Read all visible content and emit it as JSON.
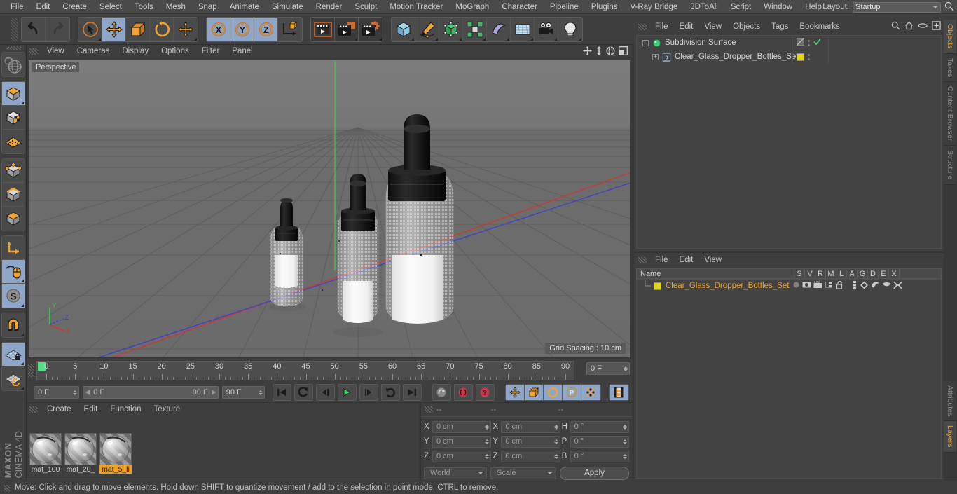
{
  "app": {
    "brand_top": "MAXON",
    "brand_bottom": "CINEMA 4D"
  },
  "menubar": {
    "items": [
      "File",
      "Edit",
      "Create",
      "Select",
      "Tools",
      "Mesh",
      "Snap",
      "Animate",
      "Simulate",
      "Render",
      "Sculpt",
      "Motion Tracker",
      "MoGraph",
      "Character",
      "Pipeline",
      "Plugins",
      "V-Ray Bridge",
      "3DToAll",
      "Script",
      "Window",
      "Help"
    ],
    "layout_label": "Layout:",
    "layout_value": "Startup"
  },
  "toolbar": {
    "undo": "undo-arrow",
    "redo": "redo-arrow",
    "tools": [
      "live-selection",
      "move",
      "scale",
      "rotate",
      "move-axis"
    ],
    "axes": [
      "X",
      "Y",
      "Z"
    ],
    "world_axis": "world-coordinate-system",
    "render_view": "render-view",
    "render_region": "render-region",
    "render_settings": "render-settings",
    "primitives": [
      "cube-primitive",
      "pen-spline",
      "generator",
      "mograph-array",
      "deformer",
      "floor-environment",
      "camera",
      "light"
    ]
  },
  "left_toolbar": {
    "items": [
      "viewport-globe",
      "cube-mode-object",
      "polygon-checker",
      "texture-axis",
      "points-mode",
      "edges-mode",
      "polygons-mode",
      "axis-modify",
      "enable-axis",
      "enable-snap",
      "magnet",
      "workplane-lock",
      "workplane-rotate"
    ]
  },
  "viewport": {
    "menu": [
      "View",
      "Cameras",
      "Display",
      "Options",
      "Filter",
      "Panel"
    ],
    "label": "Perspective",
    "grid_spacing": "Grid Spacing : 10 cm",
    "axis": {
      "x": "X",
      "y": "Y",
      "z": "Z"
    },
    "nav_icons": [
      "pan-icon",
      "dolly-icon",
      "orbit-icon",
      "maximize-icon"
    ],
    "scene": {
      "objects": "three glass dropper bottles with black droppers and white labels",
      "bg_top": "#767676",
      "bg_bottom": "#6b6b6b",
      "grid_color": "#5b5b5b",
      "axis_y_color": "#33c03a",
      "axis_x_color": "#cc3232",
      "axis_z_color": "#3a3fc0"
    }
  },
  "timeline": {
    "ticks": [
      0,
      5,
      10,
      15,
      20,
      25,
      30,
      35,
      40,
      45,
      50,
      55,
      60,
      65,
      70,
      75,
      80,
      85,
      90
    ],
    "current_frame": "0 F",
    "range_start": "0 F",
    "range_end": "90 F",
    "end_frame": "90 F",
    "right_frame": "0 F",
    "transport": [
      "go-to-start",
      "frame-back",
      "play-back",
      "play-forward",
      "frame-forward",
      "loop",
      "go-to-end"
    ],
    "record_tools": [
      "record-active-objects",
      "autokeying",
      "keyframe-selection"
    ],
    "key_tools": [
      "position-key",
      "scale-key",
      "rotation-key",
      "parameter-key",
      "point-level-animation",
      "timeline-toggle"
    ]
  },
  "materials": {
    "menu": [
      "Create",
      "Edit",
      "Function",
      "Texture"
    ],
    "items": [
      {
        "name": "mat_100",
        "selected": false
      },
      {
        "name": "mat_20_",
        "selected": false
      },
      {
        "name": "mat_5_li",
        "selected": true
      }
    ],
    "selected_color": "#f0a020"
  },
  "coordinates": {
    "headers": [
      "--",
      "--",
      "--"
    ],
    "rows": [
      {
        "l1": "X",
        "v1": "0 cm",
        "l2": "X",
        "v2": "0 cm",
        "l3": "H",
        "v3": "0 °"
      },
      {
        "l1": "Y",
        "v1": "0 cm",
        "l2": "Y",
        "v2": "0 cm",
        "l3": "P",
        "v3": "0 °"
      },
      {
        "l1": "Z",
        "v1": "0 cm",
        "l2": "Z",
        "v2": "0 cm",
        "l3": "B",
        "v3": "0 °"
      }
    ],
    "system": "World",
    "mode": "Scale",
    "apply": "Apply"
  },
  "object_manager": {
    "menu": [
      "File",
      "Edit",
      "View",
      "Objects",
      "Tags",
      "Bookmarks"
    ],
    "icons": [
      "search-icon",
      "home-icon",
      "ellipse-icon",
      "add-layer-icon"
    ],
    "rows": [
      {
        "name": "Subdivision Surface",
        "indent": 8,
        "tag": "none",
        "checked": true,
        "icon": "subdivision-surface-icon",
        "selected": false
      },
      {
        "name": "Clear_Glass_Dropper_Bottles_Set",
        "indent": 22,
        "tag": "#e0d21e",
        "checked": false,
        "icon": "null-object-icon",
        "selected": false
      }
    ]
  },
  "layer_manager": {
    "menu": [
      "File",
      "Edit",
      "View"
    ],
    "columns": [
      "Name",
      "S",
      "V",
      "R",
      "M",
      "L",
      "A",
      "G",
      "D",
      "E",
      "X"
    ],
    "rows": [
      {
        "name": "Clear_Glass_Dropper_Bottles_Set",
        "color": "#e0d21e",
        "text_color": "#f0a020"
      }
    ]
  },
  "right_tabs": {
    "top": [
      {
        "label": "Objects",
        "active": true
      },
      {
        "label": "Takes",
        "active": false
      },
      {
        "label": "Content Browser",
        "active": false
      },
      {
        "label": "Structure",
        "active": false
      }
    ],
    "bottom": [
      {
        "label": "Attributes",
        "active": false
      },
      {
        "label": "Layers",
        "active": true
      }
    ]
  },
  "status": {
    "message": "Move: Click and drag to move elements. Hold down SHIFT to quantize movement / add to the selection in point mode, CTRL to remove."
  }
}
